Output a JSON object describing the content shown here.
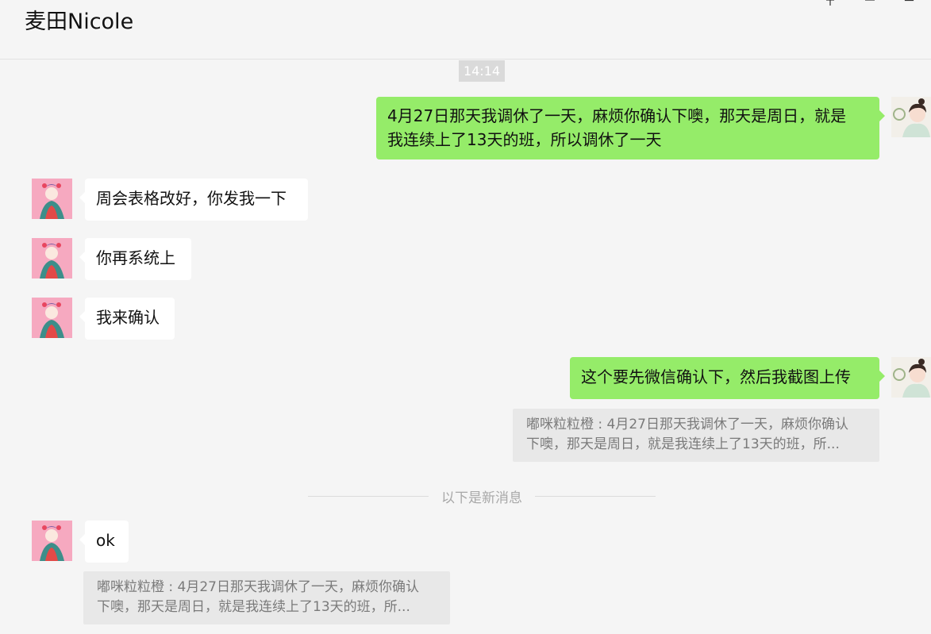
{
  "header": {
    "title": "麦田Nicole"
  },
  "window_controls": [
    "pin-icon",
    "minimize-icon",
    "maximize-icon"
  ],
  "chat": {
    "timestamp": "14:14",
    "messages": [
      {
        "side": "right",
        "lines": [
          "4月27日那天我调休了一天，麻烦你确认下噢，那天是周日，就是",
          "我连续上了13天的班，所以调休了一天"
        ]
      },
      {
        "side": "left",
        "text": "周会表格改好，你发我一下"
      },
      {
        "side": "left",
        "text": "你再系统上"
      },
      {
        "side": "left",
        "text": "我来确认"
      },
      {
        "side": "right",
        "text": "这个要先微信确认下，然后我截图上传",
        "quote": {
          "lines": [
            "嘟咪粒粒橙 : 4月27日那天我调休了一天，麻烦你确认",
            "下噢，那天是周日，就是我连续上了13天的班，所..."
          ]
        }
      },
      {
        "side": "left",
        "text": "ok",
        "quote": {
          "lines": [
            "嘟咪粒粒橙 : 4月27日那天我调休了一天，麻烦你确认",
            "下噢，那天是周日，就是我连续上了13天的班，所..."
          ]
        }
      }
    ],
    "new_messages_divider": "以下是新消息"
  },
  "colors": {
    "background": "#f5f5f5",
    "sent_bubble": "#95ec69",
    "received_bubble": "#ffffff",
    "quote_background": "#e8e8e8"
  }
}
